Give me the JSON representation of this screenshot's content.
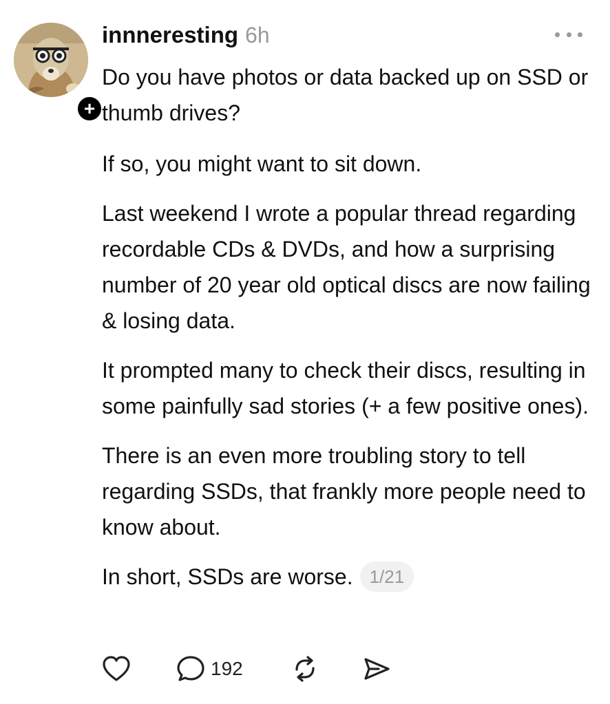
{
  "post": {
    "username": "innneresting",
    "time": "6h",
    "paragraphs": [
      "Do you have photos or data backed up on SSD or thumb drives?",
      "If so, you might want to sit down.",
      "Last weekend I wrote a popular thread regarding recordable CDs & DVDs, and how a surprising number of 20 year old optical discs are now failing & losing data.",
      "It prompted many to check their discs, resulting in some painfully sad stories (+ a few positive ones).",
      "There is an even more troubling story to tell regarding SSDs, that frankly more people need to know about.",
      "In short, SSDs are worse."
    ],
    "thread_counter": "1/21",
    "follow_badge": "+",
    "reply_count": "192"
  },
  "icons": {
    "more": "more-options-icon",
    "like": "heart-icon",
    "reply": "comment-icon",
    "repost": "repost-icon",
    "share": "send-icon"
  },
  "colors": {
    "text": "#111111",
    "muted": "#9a9a9a",
    "badge_bg": "#000000",
    "counter_bg": "#f1f1f1"
  }
}
